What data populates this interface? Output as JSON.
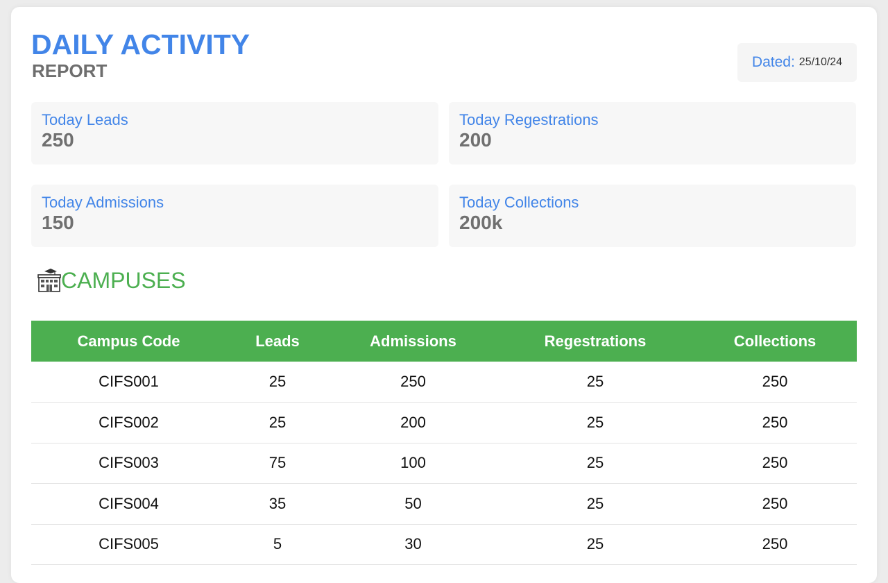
{
  "header": {
    "title": "DAILY ACTIVITY",
    "subtitle": "REPORT",
    "dated_label": "Dated:",
    "dated_value": "25/10/24"
  },
  "stats": [
    {
      "label": "Today Leads",
      "value": "250"
    },
    {
      "label": "Today Regestrations",
      "value": "200"
    },
    {
      "label": "Today Admissions",
      "value": "150"
    },
    {
      "label": "Today Collections",
      "value": "200k"
    }
  ],
  "campuses": {
    "icon": "school-building-icon",
    "title": "CAMPUSES",
    "columns": [
      "Campus Code",
      "Leads",
      "Admissions",
      "Regestrations",
      "Collections"
    ],
    "rows": [
      [
        "CIFS001",
        "25",
        "250",
        "25",
        "250"
      ],
      [
        "CIFS002",
        "25",
        "200",
        "25",
        "250"
      ],
      [
        "CIFS003",
        "75",
        "100",
        "25",
        "250"
      ],
      [
        "CIFS004",
        "35",
        "50",
        "25",
        "250"
      ],
      [
        "CIFS005",
        "5",
        "30",
        "25",
        "250"
      ]
    ]
  },
  "colors": {
    "accent_blue": "#4285e8",
    "accent_green": "#4caf50",
    "muted_gray": "#6e6e6e"
  }
}
